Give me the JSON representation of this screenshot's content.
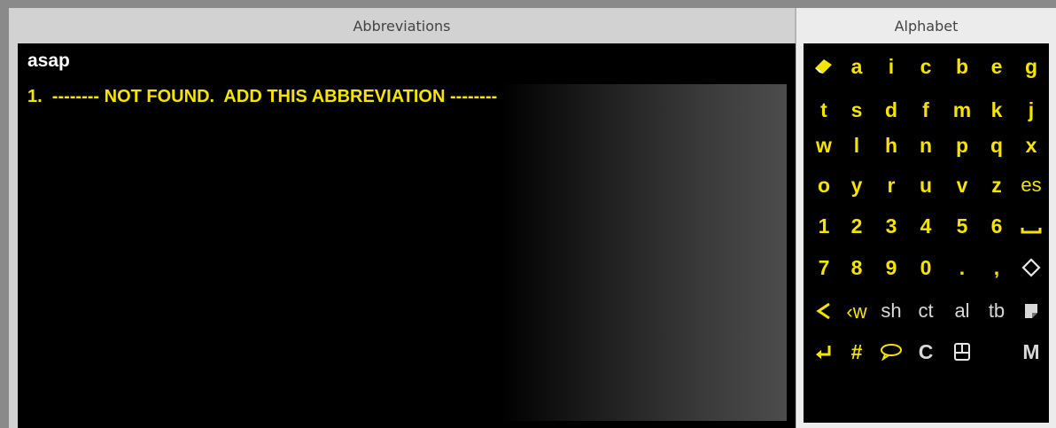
{
  "abbreviations_panel": {
    "title": "Abbreviations",
    "input_value": "asap",
    "results": [
      "1.  -------- NOT FOUND.  ADD THIS ABBREVIATION --------"
    ]
  },
  "alphabet_panel": {
    "title": "Alphabet",
    "rows": [
      [
        {
          "type": "icon",
          "icon": "eraser-icon"
        },
        {
          "type": "text",
          "label": "a"
        },
        {
          "type": "text",
          "label": "i"
        },
        {
          "type": "text",
          "label": "c"
        },
        {
          "type": "text",
          "label": "b"
        },
        {
          "type": "text",
          "label": "e"
        },
        {
          "type": "text",
          "label": "g"
        }
      ],
      [
        {
          "type": "text",
          "label": "t"
        },
        {
          "type": "text",
          "label": "s"
        },
        {
          "type": "text",
          "label": "d"
        },
        {
          "type": "text",
          "label": "f"
        },
        {
          "type": "text",
          "label": "m"
        },
        {
          "type": "text",
          "label": "k"
        },
        {
          "type": "text",
          "label": "j"
        }
      ],
      [
        {
          "type": "text",
          "label": "w"
        },
        {
          "type": "text",
          "label": "l"
        },
        {
          "type": "text",
          "label": "h"
        },
        {
          "type": "text",
          "label": "n"
        },
        {
          "type": "text",
          "label": "p"
        },
        {
          "type": "text",
          "label": "q"
        },
        {
          "type": "text",
          "label": "x"
        }
      ],
      [
        {
          "type": "text",
          "label": "o"
        },
        {
          "type": "text",
          "label": "y"
        },
        {
          "type": "text",
          "label": "r"
        },
        {
          "type": "text",
          "label": "u"
        },
        {
          "type": "text",
          "label": "v"
        },
        {
          "type": "text",
          "label": "z"
        },
        {
          "type": "text",
          "label": "es",
          "style": "thin"
        }
      ],
      [
        {
          "type": "text",
          "label": "1"
        },
        {
          "type": "text",
          "label": "2"
        },
        {
          "type": "text",
          "label": "3"
        },
        {
          "type": "text",
          "label": "4"
        },
        {
          "type": "text",
          "label": "5"
        },
        {
          "type": "text",
          "label": "6"
        },
        {
          "type": "icon",
          "icon": "space-icon"
        }
      ],
      [
        {
          "type": "text",
          "label": "7"
        },
        {
          "type": "text",
          "label": "8"
        },
        {
          "type": "text",
          "label": "9"
        },
        {
          "type": "text",
          "label": "0"
        },
        {
          "type": "text",
          "label": "."
        },
        {
          "type": "text",
          "label": ","
        },
        {
          "type": "icon",
          "icon": "diamond-icon"
        }
      ],
      [
        {
          "type": "icon",
          "icon": "back-arrow-icon"
        },
        {
          "type": "icon",
          "icon": "back-word-icon",
          "label": "w"
        },
        {
          "type": "text",
          "label": "sh",
          "style": "white-thin"
        },
        {
          "type": "text",
          "label": "ct",
          "style": "white-thin"
        },
        {
          "type": "text",
          "label": "al",
          "style": "white-thin"
        },
        {
          "type": "text",
          "label": "tb",
          "style": "white-thin"
        },
        {
          "type": "icon",
          "icon": "note-icon"
        }
      ],
      [
        {
          "type": "icon",
          "icon": "enter-icon"
        },
        {
          "type": "text",
          "label": "#"
        },
        {
          "type": "icon",
          "icon": "speech-bubble-icon"
        },
        {
          "type": "text",
          "label": "C",
          "style": "white"
        },
        {
          "type": "icon",
          "icon": "keypad-icon"
        },
        {
          "type": "text",
          "label": ""
        },
        {
          "type": "text",
          "label": "M",
          "style": "white"
        }
      ]
    ],
    "colors": {
      "key_text": "#f4e400",
      "key_background": "#000000",
      "alt_key_text": "#d8d8d8"
    }
  }
}
